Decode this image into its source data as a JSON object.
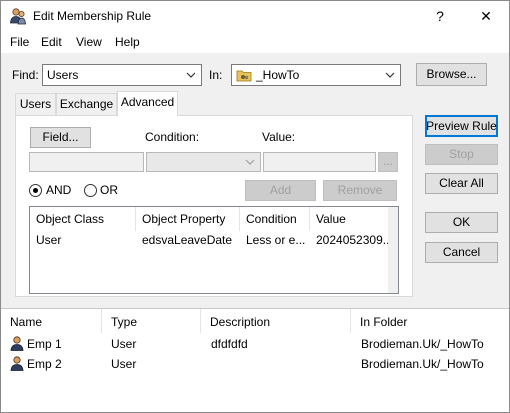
{
  "window": {
    "title": "Edit Membership Rule",
    "help_label": "?",
    "close_label": "✕"
  },
  "menu": [
    "File",
    "Edit",
    "View",
    "Help"
  ],
  "find": {
    "label": "Find:",
    "value": "Users",
    "in_label": "In:",
    "in_value": "_HowTo",
    "browse_label": "Browse..."
  },
  "tabs": [
    "Users",
    "Exchange",
    "Advanced"
  ],
  "advanced": {
    "field_label": "Field...",
    "condition_label": "Condition:",
    "value_label": "Value:",
    "ellipsis": "...",
    "and_label": "AND",
    "or_label": "OR",
    "add_label": "Add",
    "remove_label": "Remove",
    "columns": [
      "Object Class",
      "Object Property",
      "Condition",
      "Value"
    ],
    "rows": [
      {
        "object_class": "User",
        "object_property": "edsvaLeaveDate",
        "condition": "Less or e...",
        "value": "2024052309..."
      }
    ]
  },
  "side_buttons": {
    "preview": "Preview Rule",
    "stop": "Stop",
    "clear_all": "Clear All",
    "ok": "OK",
    "cancel": "Cancel"
  },
  "results": {
    "columns": [
      "Name",
      "Type",
      "Description",
      "In Folder"
    ],
    "rows": [
      {
        "name": "Emp 1",
        "type": "User",
        "description": "dfdfdfd",
        "folder": "Brodieman.Uk/_HowTo"
      },
      {
        "name": "Emp 2",
        "type": "User",
        "description": "",
        "folder": "Brodieman.Uk/_HowTo"
      }
    ]
  }
}
